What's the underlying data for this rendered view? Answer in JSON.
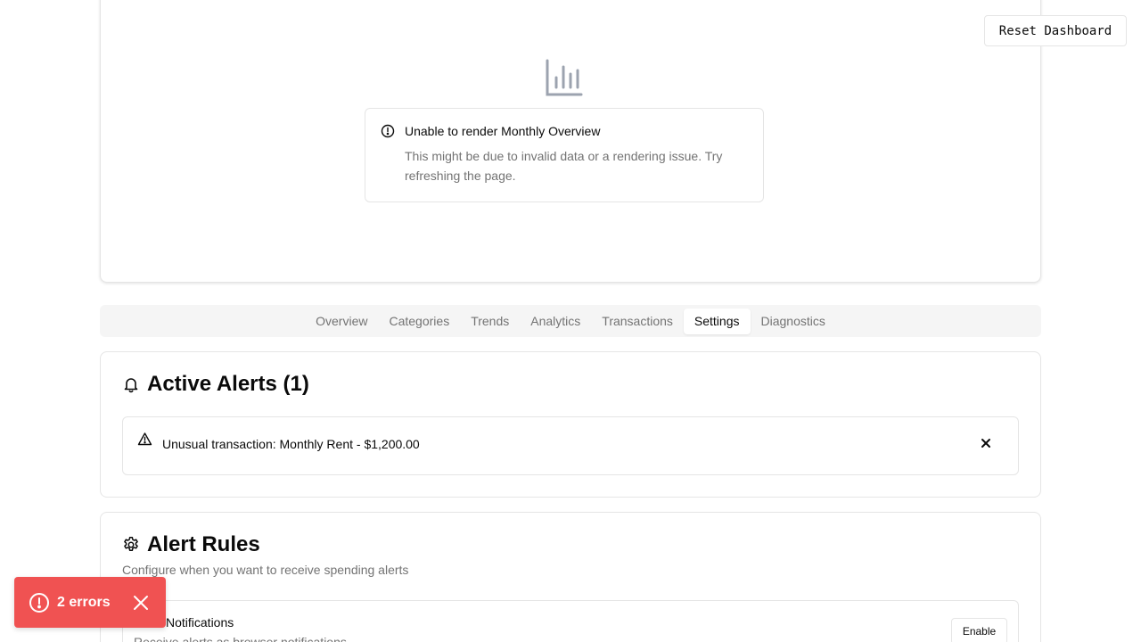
{
  "header": {
    "reset_label": "Reset Dashboard"
  },
  "chart_error": {
    "icon": "bar-chart-icon",
    "title": "Unable to render Monthly Overview",
    "description": "This might be due to invalid data or a rendering issue. Try refreshing the page."
  },
  "tabs": [
    {
      "label": "Overview",
      "active": false
    },
    {
      "label": "Categories",
      "active": false
    },
    {
      "label": "Trends",
      "active": false
    },
    {
      "label": "Analytics",
      "active": false
    },
    {
      "label": "Transactions",
      "active": false
    },
    {
      "label": "Settings",
      "active": true
    },
    {
      "label": "Diagnostics",
      "active": false
    }
  ],
  "alerts": {
    "title": "Active Alerts (1)",
    "items": [
      {
        "text": "Unusual transaction: Monthly Rent - $1,200.00"
      }
    ]
  },
  "rules": {
    "title": "Alert Rules",
    "subtitle": "Configure when you want to receive spending alerts",
    "notifications": {
      "title": "Notifications",
      "description": "Receive alerts as browser notifications",
      "enable_label": "Enable"
    }
  },
  "toast": {
    "text": "2 errors",
    "color": "#f05252"
  },
  "colors": {
    "muted": "#737373",
    "border": "#e5e5e5",
    "tabs_bg": "#f5f5f5"
  }
}
